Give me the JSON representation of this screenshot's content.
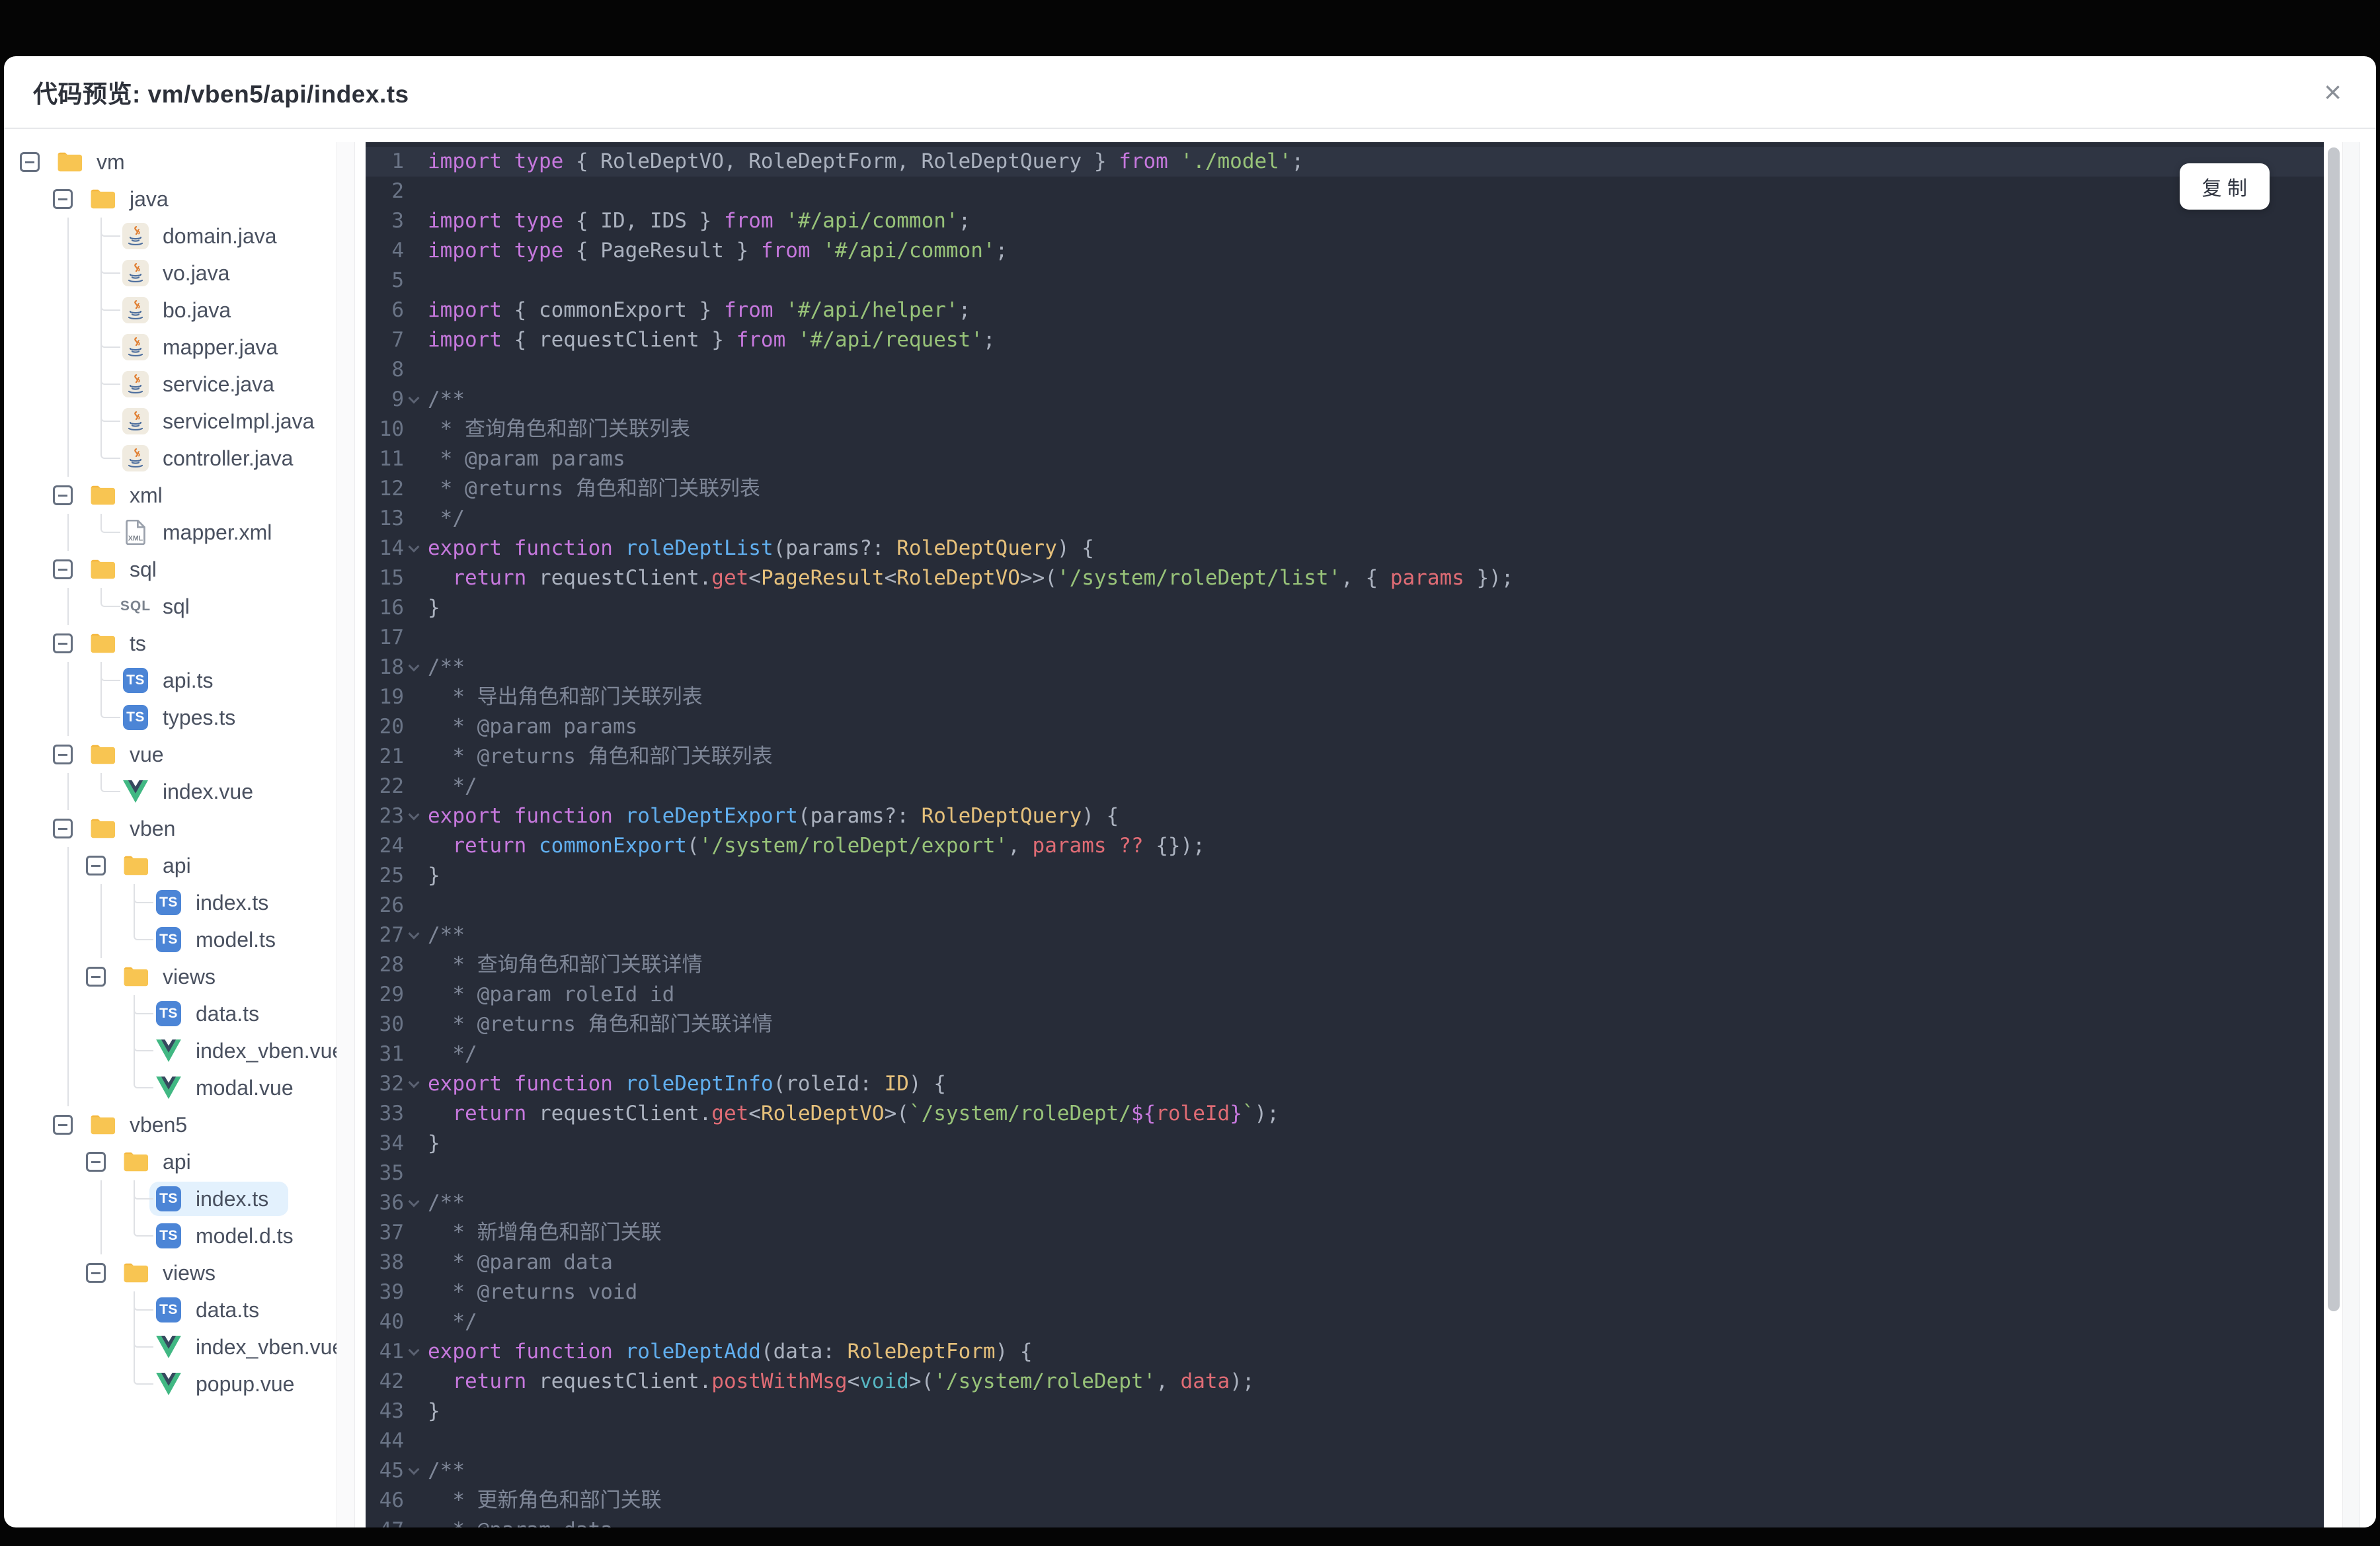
{
  "header": {
    "title": "代码预览: vm/vben5/api/index.ts",
    "close_icon": "×"
  },
  "code_panel": {
    "copy_button": "复 制"
  },
  "colors": {
    "code_background": "#272c38",
    "current_line": "#2f3543",
    "keyword": "#c678dd",
    "function_name": "#61afef",
    "type": "#e5c07b",
    "string": "#98c379",
    "property": "#e06c75",
    "builtin": "#56b6c2",
    "plain": "#abb2bf",
    "comment": "#7f8798",
    "line_number": "#6a7486",
    "tree_selected_background": "#e3f1fd",
    "folder_icon": "#f8c552",
    "ts_icon_background": "#4c85d6",
    "vue_green": "#41b883",
    "vue_dark": "#35495e"
  },
  "tree": [
    {
      "label": "vm",
      "icon": "folder",
      "level": 0,
      "toggle": true
    },
    {
      "label": "java",
      "icon": "folder",
      "level": 1,
      "toggle": true
    },
    {
      "label": "domain.java",
      "icon": "java",
      "level": 2
    },
    {
      "label": "vo.java",
      "icon": "java",
      "level": 2
    },
    {
      "label": "bo.java",
      "icon": "java",
      "level": 2
    },
    {
      "label": "mapper.java",
      "icon": "java",
      "level": 2
    },
    {
      "label": "service.java",
      "icon": "java",
      "level": 2
    },
    {
      "label": "serviceImpl.java",
      "icon": "java",
      "level": 2
    },
    {
      "label": "controller.java",
      "icon": "java",
      "level": 2
    },
    {
      "label": "xml",
      "icon": "folder",
      "level": 1,
      "toggle": true
    },
    {
      "label": "mapper.xml",
      "icon": "xml",
      "level": 2
    },
    {
      "label": "sql",
      "icon": "folder",
      "level": 1,
      "toggle": true
    },
    {
      "label": "sql",
      "icon": "sql",
      "level": 2
    },
    {
      "label": "ts",
      "icon": "folder",
      "level": 1,
      "toggle": true
    },
    {
      "label": "api.ts",
      "icon": "ts",
      "level": 2
    },
    {
      "label": "types.ts",
      "icon": "ts",
      "level": 2
    },
    {
      "label": "vue",
      "icon": "folder",
      "level": 1,
      "toggle": true
    },
    {
      "label": "index.vue",
      "icon": "vue",
      "level": 2
    },
    {
      "label": "vben",
      "icon": "folder",
      "level": 1,
      "toggle": true
    },
    {
      "label": "api",
      "icon": "folder",
      "level": 2,
      "toggle": true
    },
    {
      "label": "index.ts",
      "icon": "ts",
      "level": 3
    },
    {
      "label": "model.ts",
      "icon": "ts",
      "level": 3
    },
    {
      "label": "views",
      "icon": "folder",
      "level": 2,
      "toggle": true
    },
    {
      "label": "data.ts",
      "icon": "ts",
      "level": 3
    },
    {
      "label": "index_vben.vue",
      "icon": "vue",
      "level": 3
    },
    {
      "label": "modal.vue",
      "icon": "vue",
      "level": 3
    },
    {
      "label": "vben5",
      "icon": "folder",
      "level": 1,
      "toggle": true
    },
    {
      "label": "api",
      "icon": "folder",
      "level": 2,
      "toggle": true
    },
    {
      "label": "index.ts",
      "icon": "ts",
      "level": 3,
      "selected": true
    },
    {
      "label": "model.d.ts",
      "icon": "ts",
      "level": 3
    },
    {
      "label": "views",
      "icon": "folder",
      "level": 2,
      "toggle": true
    },
    {
      "label": "data.ts",
      "icon": "ts",
      "level": 3
    },
    {
      "label": "index_vben.vue",
      "icon": "vue",
      "level": 3
    },
    {
      "label": "popup.vue",
      "icon": "vue",
      "level": 3
    }
  ],
  "code": {
    "current_line": 1,
    "fold_lines": [
      9,
      14,
      18,
      23,
      27,
      32,
      36,
      41,
      45
    ],
    "lines": [
      {
        "n": 1,
        "seg": [
          [
            "kw",
            "import type"
          ],
          [
            "pl",
            " { RoleDeptVO, RoleDeptForm, RoleDeptQuery } "
          ],
          [
            "kw",
            "from"
          ],
          [
            "pl",
            " "
          ],
          [
            "str",
            "'./model'"
          ],
          [
            "pl",
            ";"
          ]
        ]
      },
      {
        "n": 2,
        "seg": []
      },
      {
        "n": 3,
        "seg": [
          [
            "kw",
            "import type"
          ],
          [
            "pl",
            " { ID, IDS } "
          ],
          [
            "kw",
            "from"
          ],
          [
            "pl",
            " "
          ],
          [
            "str",
            "'#/api/common'"
          ],
          [
            "pl",
            ";"
          ]
        ]
      },
      {
        "n": 4,
        "seg": [
          [
            "kw",
            "import type"
          ],
          [
            "pl",
            " { PageResult } "
          ],
          [
            "kw",
            "from"
          ],
          [
            "pl",
            " "
          ],
          [
            "str",
            "'#/api/common'"
          ],
          [
            "pl",
            ";"
          ]
        ]
      },
      {
        "n": 5,
        "seg": []
      },
      {
        "n": 6,
        "seg": [
          [
            "kw",
            "import"
          ],
          [
            "pl",
            " { commonExport } "
          ],
          [
            "kw",
            "from"
          ],
          [
            "pl",
            " "
          ],
          [
            "str",
            "'#/api/helper'"
          ],
          [
            "pl",
            ";"
          ]
        ]
      },
      {
        "n": 7,
        "seg": [
          [
            "kw",
            "import"
          ],
          [
            "pl",
            " { requestClient } "
          ],
          [
            "kw",
            "from"
          ],
          [
            "pl",
            " "
          ],
          [
            "str",
            "'#/api/request'"
          ],
          [
            "pl",
            ";"
          ]
        ]
      },
      {
        "n": 8,
        "seg": []
      },
      {
        "n": 9,
        "seg": [
          [
            "cm",
            "/**"
          ]
        ]
      },
      {
        "n": 10,
        "seg": [
          [
            "cm",
            " * 查询角色和部门关联列表"
          ]
        ]
      },
      {
        "n": 11,
        "seg": [
          [
            "cm",
            " * @param params"
          ]
        ]
      },
      {
        "n": 12,
        "seg": [
          [
            "cm",
            " * @returns 角色和部门关联列表"
          ]
        ]
      },
      {
        "n": 13,
        "seg": [
          [
            "cm",
            " */"
          ]
        ]
      },
      {
        "n": 14,
        "seg": [
          [
            "kw",
            "export"
          ],
          [
            "pl",
            " "
          ],
          [
            "kw",
            "function"
          ],
          [
            "pl",
            " "
          ],
          [
            "fn",
            "roleDeptList"
          ],
          [
            "pl",
            "(params?: "
          ],
          [
            "ty",
            "RoleDeptQuery"
          ],
          [
            "pl",
            ") {"
          ]
        ]
      },
      {
        "n": 15,
        "seg": [
          [
            "pl",
            "  "
          ],
          [
            "kw",
            "return"
          ],
          [
            "pl",
            " requestClient."
          ],
          [
            "red",
            "get"
          ],
          [
            "pl",
            "<"
          ],
          [
            "ty",
            "PageResult"
          ],
          [
            "pl",
            "<"
          ],
          [
            "ty",
            "RoleDeptVO"
          ],
          [
            "pl",
            ">>("
          ],
          [
            "str",
            "'/system/roleDept/list'"
          ],
          [
            "pl",
            ", { "
          ],
          [
            "red",
            "params"
          ],
          [
            "pl",
            " });"
          ]
        ]
      },
      {
        "n": 16,
        "seg": [
          [
            "pl",
            "}"
          ]
        ]
      },
      {
        "n": 17,
        "seg": []
      },
      {
        "n": 18,
        "seg": [
          [
            "cm",
            "/**"
          ]
        ]
      },
      {
        "n": 19,
        "seg": [
          [
            "cm",
            "  * 导出角色和部门关联列表"
          ]
        ]
      },
      {
        "n": 20,
        "seg": [
          [
            "cm",
            "  * @param params"
          ]
        ]
      },
      {
        "n": 21,
        "seg": [
          [
            "cm",
            "  * @returns 角色和部门关联列表"
          ]
        ]
      },
      {
        "n": 22,
        "seg": [
          [
            "cm",
            "  */"
          ]
        ]
      },
      {
        "n": 23,
        "seg": [
          [
            "kw",
            "export"
          ],
          [
            "pl",
            " "
          ],
          [
            "kw",
            "function"
          ],
          [
            "pl",
            " "
          ],
          [
            "fn",
            "roleDeptExport"
          ],
          [
            "pl",
            "(params?: "
          ],
          [
            "ty",
            "RoleDeptQuery"
          ],
          [
            "pl",
            ") {"
          ]
        ]
      },
      {
        "n": 24,
        "seg": [
          [
            "pl",
            "  "
          ],
          [
            "kw",
            "return"
          ],
          [
            "pl",
            " "
          ],
          [
            "fn",
            "commonExport"
          ],
          [
            "pl",
            "("
          ],
          [
            "str",
            "'/system/roleDept/export'"
          ],
          [
            "pl",
            ", "
          ],
          [
            "red",
            "params"
          ],
          [
            "pl",
            " "
          ],
          [
            "red",
            "??"
          ],
          [
            "pl",
            " {});"
          ]
        ]
      },
      {
        "n": 25,
        "seg": [
          [
            "pl",
            "}"
          ]
        ]
      },
      {
        "n": 26,
        "seg": []
      },
      {
        "n": 27,
        "seg": [
          [
            "cm",
            "/**"
          ]
        ]
      },
      {
        "n": 28,
        "seg": [
          [
            "cm",
            "  * 查询角色和部门关联详情"
          ]
        ]
      },
      {
        "n": 29,
        "seg": [
          [
            "cm",
            "  * @param roleId id"
          ]
        ]
      },
      {
        "n": 30,
        "seg": [
          [
            "cm",
            "  * @returns 角色和部门关联详情"
          ]
        ]
      },
      {
        "n": 31,
        "seg": [
          [
            "cm",
            "  */"
          ]
        ]
      },
      {
        "n": 32,
        "seg": [
          [
            "kw",
            "export"
          ],
          [
            "pl",
            " "
          ],
          [
            "kw",
            "function"
          ],
          [
            "pl",
            " "
          ],
          [
            "fn",
            "roleDeptInfo"
          ],
          [
            "pl",
            "(roleId: "
          ],
          [
            "ty",
            "ID"
          ],
          [
            "pl",
            ") {"
          ]
        ]
      },
      {
        "n": 33,
        "seg": [
          [
            "pl",
            "  "
          ],
          [
            "kw",
            "return"
          ],
          [
            "pl",
            " requestClient."
          ],
          [
            "red",
            "get"
          ],
          [
            "pl",
            "<"
          ],
          [
            "ty",
            "RoleDeptVO"
          ],
          [
            "pl",
            ">("
          ],
          [
            "str",
            "`/system/roleDept/"
          ],
          [
            "kw",
            "${"
          ],
          [
            "red",
            "roleId"
          ],
          [
            "kw",
            "}"
          ],
          [
            "str",
            "`"
          ],
          [
            "pl",
            ");"
          ]
        ]
      },
      {
        "n": 34,
        "seg": [
          [
            "pl",
            "}"
          ]
        ]
      },
      {
        "n": 35,
        "seg": []
      },
      {
        "n": 36,
        "seg": [
          [
            "cm",
            "/**"
          ]
        ]
      },
      {
        "n": 37,
        "seg": [
          [
            "cm",
            "  * 新增角色和部门关联"
          ]
        ]
      },
      {
        "n": 38,
        "seg": [
          [
            "cm",
            "  * @param data"
          ]
        ]
      },
      {
        "n": 39,
        "seg": [
          [
            "cm",
            "  * @returns void"
          ]
        ]
      },
      {
        "n": 40,
        "seg": [
          [
            "cm",
            "  */"
          ]
        ]
      },
      {
        "n": 41,
        "seg": [
          [
            "kw",
            "export"
          ],
          [
            "pl",
            " "
          ],
          [
            "kw",
            "function"
          ],
          [
            "pl",
            " "
          ],
          [
            "fn",
            "roleDeptAdd"
          ],
          [
            "pl",
            "(data: "
          ],
          [
            "ty",
            "RoleDeptForm"
          ],
          [
            "pl",
            ") {"
          ]
        ]
      },
      {
        "n": 42,
        "seg": [
          [
            "pl",
            "  "
          ],
          [
            "kw",
            "return"
          ],
          [
            "pl",
            " requestClient."
          ],
          [
            "red",
            "postWithMsg"
          ],
          [
            "pl",
            "<"
          ],
          [
            "cy",
            "void"
          ],
          [
            "pl",
            ">("
          ],
          [
            "str",
            "'/system/roleDept'"
          ],
          [
            "pl",
            ", "
          ],
          [
            "red",
            "data"
          ],
          [
            "pl",
            ");"
          ]
        ]
      },
      {
        "n": 43,
        "seg": [
          [
            "pl",
            "}"
          ]
        ]
      },
      {
        "n": 44,
        "seg": []
      },
      {
        "n": 45,
        "seg": [
          [
            "cm",
            "/**"
          ]
        ]
      },
      {
        "n": 46,
        "seg": [
          [
            "cm",
            "  * 更新角色和部门关联"
          ]
        ]
      },
      {
        "n": 47,
        "seg": [
          [
            "cm",
            "  * @param data"
          ]
        ]
      }
    ]
  }
}
